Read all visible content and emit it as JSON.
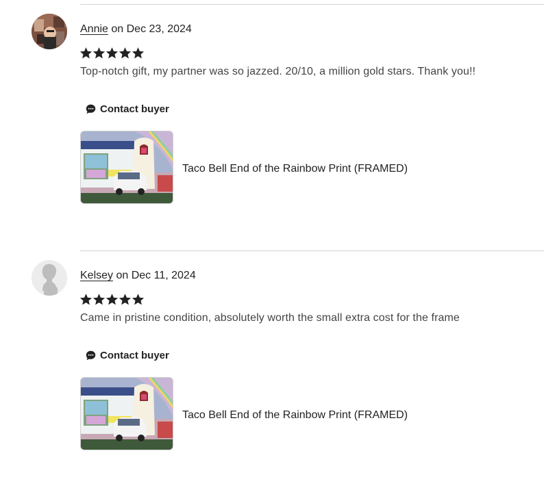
{
  "reviews": [
    {
      "reviewer": "Annie",
      "date_text": "on Dec 23, 2024",
      "rating": 5,
      "text": "Top-notch gift, my partner was so jazzed. 20/10, a million gold stars. Thank you!!",
      "contact_label": "Contact buyer",
      "listing_title": "Taco Bell End of the Rainbow Print (FRAMED)",
      "avatar": "photo-avatar"
    },
    {
      "reviewer": "Kelsey",
      "date_text": "on Dec 11, 2024",
      "rating": 5,
      "text": "Came in pristine condition, absolutely worth the small extra cost for the frame",
      "contact_label": "Contact buyer",
      "listing_title": "Taco Bell End of the Rainbow Print (FRAMED)",
      "avatar": "default-silhouette-avatar"
    }
  ],
  "icons": {
    "star": "star-icon",
    "contact": "chat-bubble-icon"
  },
  "colors": {
    "text": "#222222",
    "muted_text": "#444444",
    "divider": "#d4d4d4",
    "star": "#222222"
  }
}
